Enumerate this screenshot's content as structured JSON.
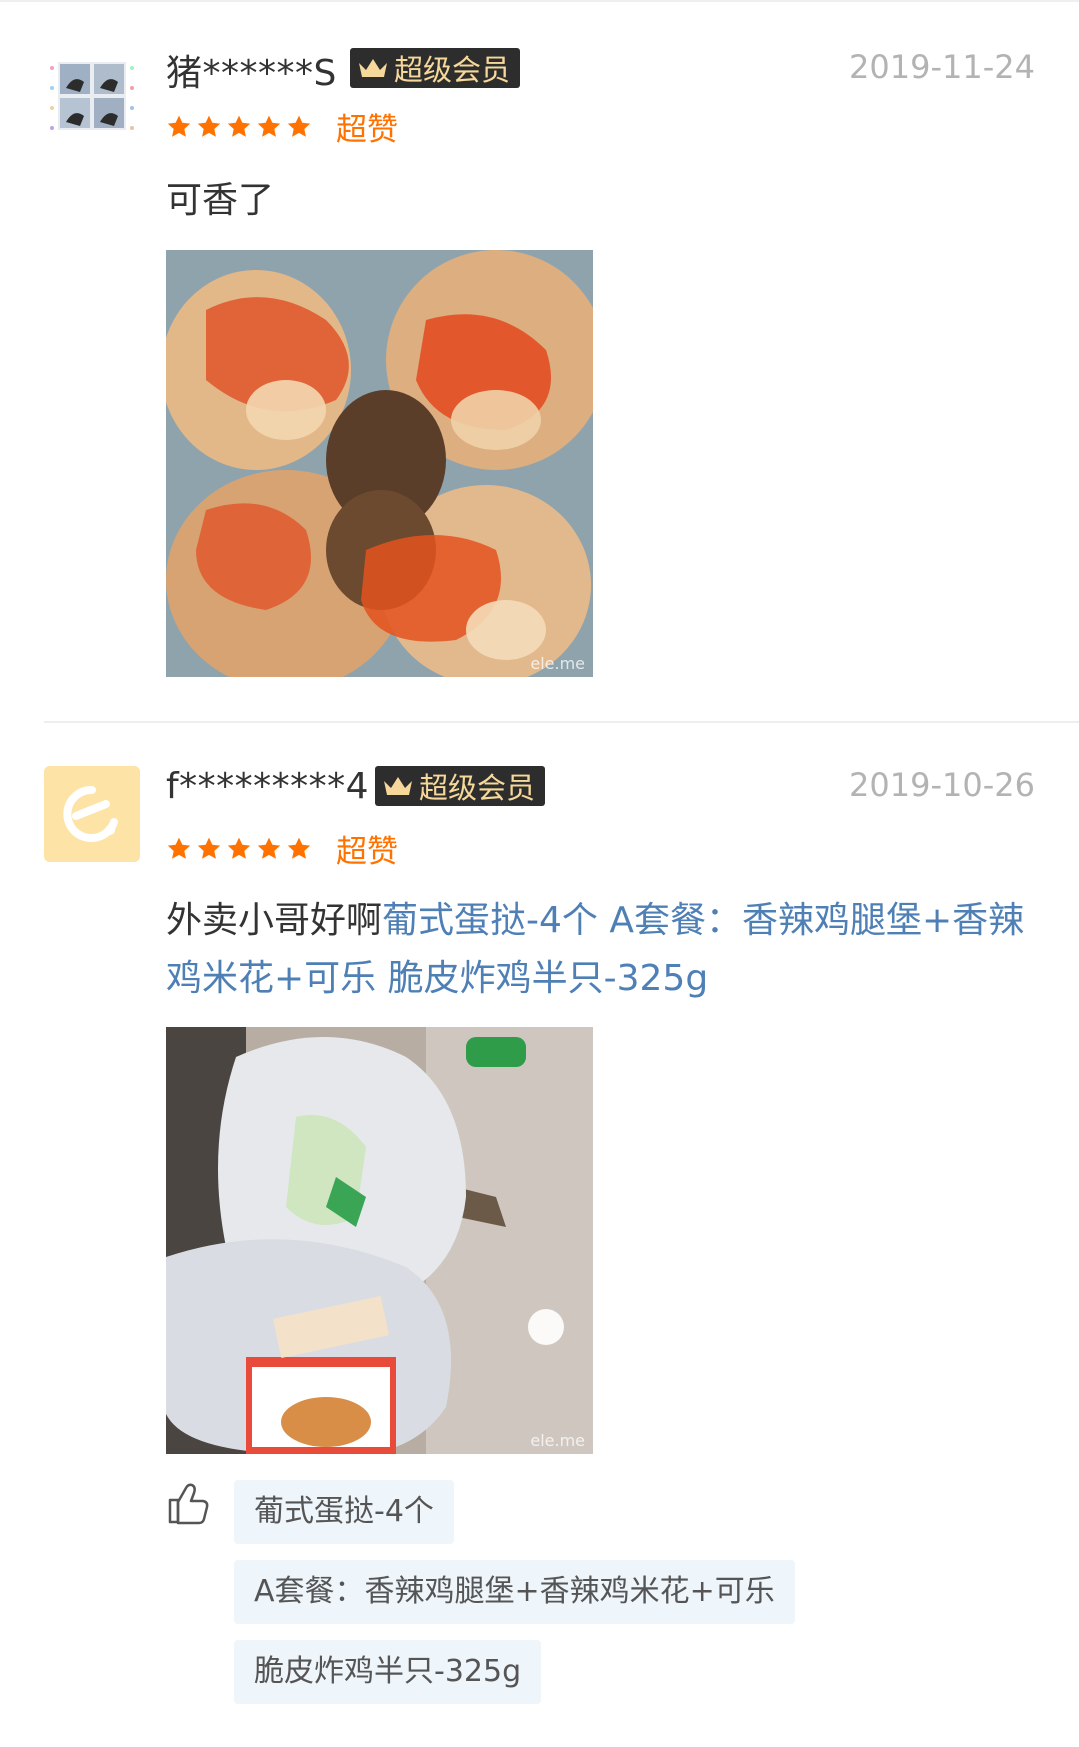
{
  "colors": {
    "accent_orange": "#ff7200",
    "link_blue": "#4e7fb5",
    "vip_gold": "#f6d89b",
    "vip_bg": "#2d2d2d",
    "chip_bg": "#eef5fb"
  },
  "reviews": [
    {
      "username": "猪******S",
      "vip_label": "超级会员",
      "date": "2019-11-24",
      "stars": 5,
      "rating_word": "超赞",
      "text": "可香了",
      "dish_tags_inline": [],
      "photo_icon": "fried-chicken-photo",
      "watermark": "ele.me",
      "liked_dishes": []
    },
    {
      "username": "f*********4",
      "vip_label": "超级会员",
      "date": "2019-10-26",
      "stars": 5,
      "rating_word": "超赞",
      "text": "外卖小哥好啊",
      "dish_tags_inline": [
        "葡式蛋挞-4个",
        "A套餐：香辣鸡腿堡+香辣鸡米花+可乐",
        "脆皮炸鸡半只-325g"
      ],
      "photo_icon": "delivery-bags-photo",
      "watermark": "ele.me",
      "liked_dishes": [
        "葡式蛋挞-4个",
        "A套餐：香辣鸡腿堡+香辣鸡米花+可乐",
        "脆皮炸鸡半只-325g"
      ]
    }
  ]
}
